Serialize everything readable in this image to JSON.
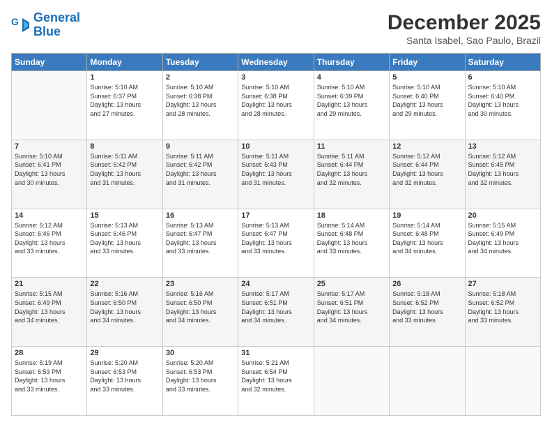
{
  "header": {
    "logo_line1": "General",
    "logo_line2": "Blue",
    "title": "December 2025",
    "subtitle": "Santa Isabel, Sao Paulo, Brazil"
  },
  "days_of_week": [
    "Sunday",
    "Monday",
    "Tuesday",
    "Wednesday",
    "Thursday",
    "Friday",
    "Saturday"
  ],
  "weeks": [
    [
      {
        "num": "",
        "detail": ""
      },
      {
        "num": "1",
        "detail": "Sunrise: 5:10 AM\nSunset: 6:37 PM\nDaylight: 13 hours\nand 27 minutes."
      },
      {
        "num": "2",
        "detail": "Sunrise: 5:10 AM\nSunset: 6:38 PM\nDaylight: 13 hours\nand 28 minutes."
      },
      {
        "num": "3",
        "detail": "Sunrise: 5:10 AM\nSunset: 6:38 PM\nDaylight: 13 hours\nand 28 minutes."
      },
      {
        "num": "4",
        "detail": "Sunrise: 5:10 AM\nSunset: 6:39 PM\nDaylight: 13 hours\nand 29 minutes."
      },
      {
        "num": "5",
        "detail": "Sunrise: 5:10 AM\nSunset: 6:40 PM\nDaylight: 13 hours\nand 29 minutes."
      },
      {
        "num": "6",
        "detail": "Sunrise: 5:10 AM\nSunset: 6:40 PM\nDaylight: 13 hours\nand 30 minutes."
      }
    ],
    [
      {
        "num": "7",
        "detail": "Sunrise: 5:10 AM\nSunset: 6:41 PM\nDaylight: 13 hours\nand 30 minutes."
      },
      {
        "num": "8",
        "detail": "Sunrise: 5:11 AM\nSunset: 6:42 PM\nDaylight: 13 hours\nand 31 minutes."
      },
      {
        "num": "9",
        "detail": "Sunrise: 5:11 AM\nSunset: 6:42 PM\nDaylight: 13 hours\nand 31 minutes."
      },
      {
        "num": "10",
        "detail": "Sunrise: 5:11 AM\nSunset: 6:43 PM\nDaylight: 13 hours\nand 31 minutes."
      },
      {
        "num": "11",
        "detail": "Sunrise: 5:11 AM\nSunset: 6:44 PM\nDaylight: 13 hours\nand 32 minutes."
      },
      {
        "num": "12",
        "detail": "Sunrise: 5:12 AM\nSunset: 6:44 PM\nDaylight: 13 hours\nand 32 minutes."
      },
      {
        "num": "13",
        "detail": "Sunrise: 5:12 AM\nSunset: 6:45 PM\nDaylight: 13 hours\nand 32 minutes."
      }
    ],
    [
      {
        "num": "14",
        "detail": "Sunrise: 5:12 AM\nSunset: 6:46 PM\nDaylight: 13 hours\nand 33 minutes."
      },
      {
        "num": "15",
        "detail": "Sunrise: 5:13 AM\nSunset: 6:46 PM\nDaylight: 13 hours\nand 33 minutes."
      },
      {
        "num": "16",
        "detail": "Sunrise: 5:13 AM\nSunset: 6:47 PM\nDaylight: 13 hours\nand 33 minutes."
      },
      {
        "num": "17",
        "detail": "Sunrise: 5:13 AM\nSunset: 6:47 PM\nDaylight: 13 hours\nand 33 minutes."
      },
      {
        "num": "18",
        "detail": "Sunrise: 5:14 AM\nSunset: 6:48 PM\nDaylight: 13 hours\nand 33 minutes."
      },
      {
        "num": "19",
        "detail": "Sunrise: 5:14 AM\nSunset: 6:48 PM\nDaylight: 13 hours\nand 34 minutes."
      },
      {
        "num": "20",
        "detail": "Sunrise: 5:15 AM\nSunset: 6:49 PM\nDaylight: 13 hours\nand 34 minutes."
      }
    ],
    [
      {
        "num": "21",
        "detail": "Sunrise: 5:15 AM\nSunset: 6:49 PM\nDaylight: 13 hours\nand 34 minutes."
      },
      {
        "num": "22",
        "detail": "Sunrise: 5:16 AM\nSunset: 6:50 PM\nDaylight: 13 hours\nand 34 minutes."
      },
      {
        "num": "23",
        "detail": "Sunrise: 5:16 AM\nSunset: 6:50 PM\nDaylight: 13 hours\nand 34 minutes."
      },
      {
        "num": "24",
        "detail": "Sunrise: 5:17 AM\nSunset: 6:51 PM\nDaylight: 13 hours\nand 34 minutes."
      },
      {
        "num": "25",
        "detail": "Sunrise: 5:17 AM\nSunset: 6:51 PM\nDaylight: 13 hours\nand 34 minutes."
      },
      {
        "num": "26",
        "detail": "Sunrise: 5:18 AM\nSunset: 6:52 PM\nDaylight: 13 hours\nand 33 minutes."
      },
      {
        "num": "27",
        "detail": "Sunrise: 5:18 AM\nSunset: 6:52 PM\nDaylight: 13 hours\nand 33 minutes."
      }
    ],
    [
      {
        "num": "28",
        "detail": "Sunrise: 5:19 AM\nSunset: 6:53 PM\nDaylight: 13 hours\nand 33 minutes."
      },
      {
        "num": "29",
        "detail": "Sunrise: 5:20 AM\nSunset: 6:53 PM\nDaylight: 13 hours\nand 33 minutes."
      },
      {
        "num": "30",
        "detail": "Sunrise: 5:20 AM\nSunset: 6:53 PM\nDaylight: 13 hours\nand 33 minutes."
      },
      {
        "num": "31",
        "detail": "Sunrise: 5:21 AM\nSunset: 6:54 PM\nDaylight: 13 hours\nand 32 minutes."
      },
      {
        "num": "",
        "detail": ""
      },
      {
        "num": "",
        "detail": ""
      },
      {
        "num": "",
        "detail": ""
      }
    ]
  ]
}
